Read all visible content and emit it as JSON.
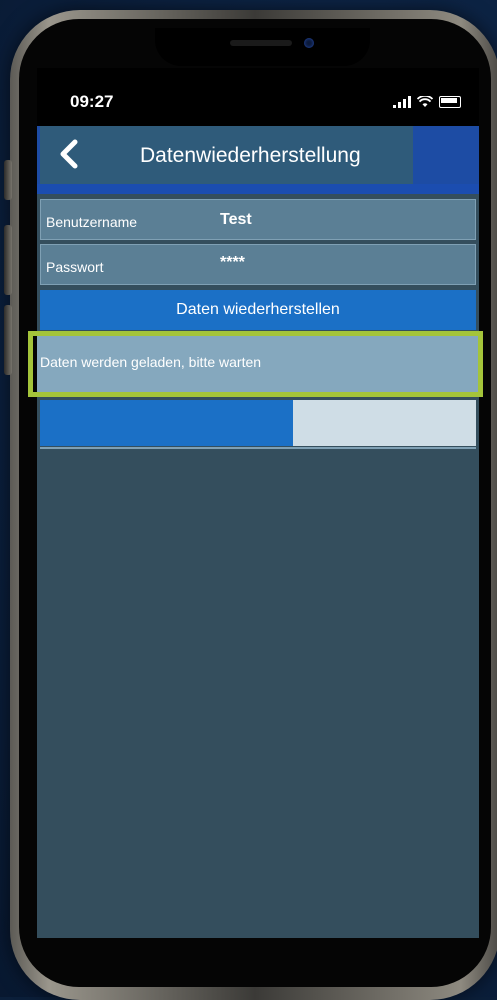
{
  "status_bar": {
    "time": "09:27"
  },
  "header": {
    "back_icon": "chevron-left-icon",
    "title": "Datenwiederherstellung"
  },
  "form": {
    "username_label": "Benutzername",
    "username_value": "Test",
    "password_label": "Passwort",
    "password_value": "****"
  },
  "restore_button": {
    "label": "Daten wiederherstellen"
  },
  "status": {
    "message": "Daten werden geladen, bitte warten"
  },
  "progress": {
    "value_percent": 58
  },
  "colors": {
    "header_blue": "#1d4ca4",
    "button_blue": "#1b70c6",
    "screen_bg": "#344e5d",
    "highlight_green": "#a4c43a"
  }
}
